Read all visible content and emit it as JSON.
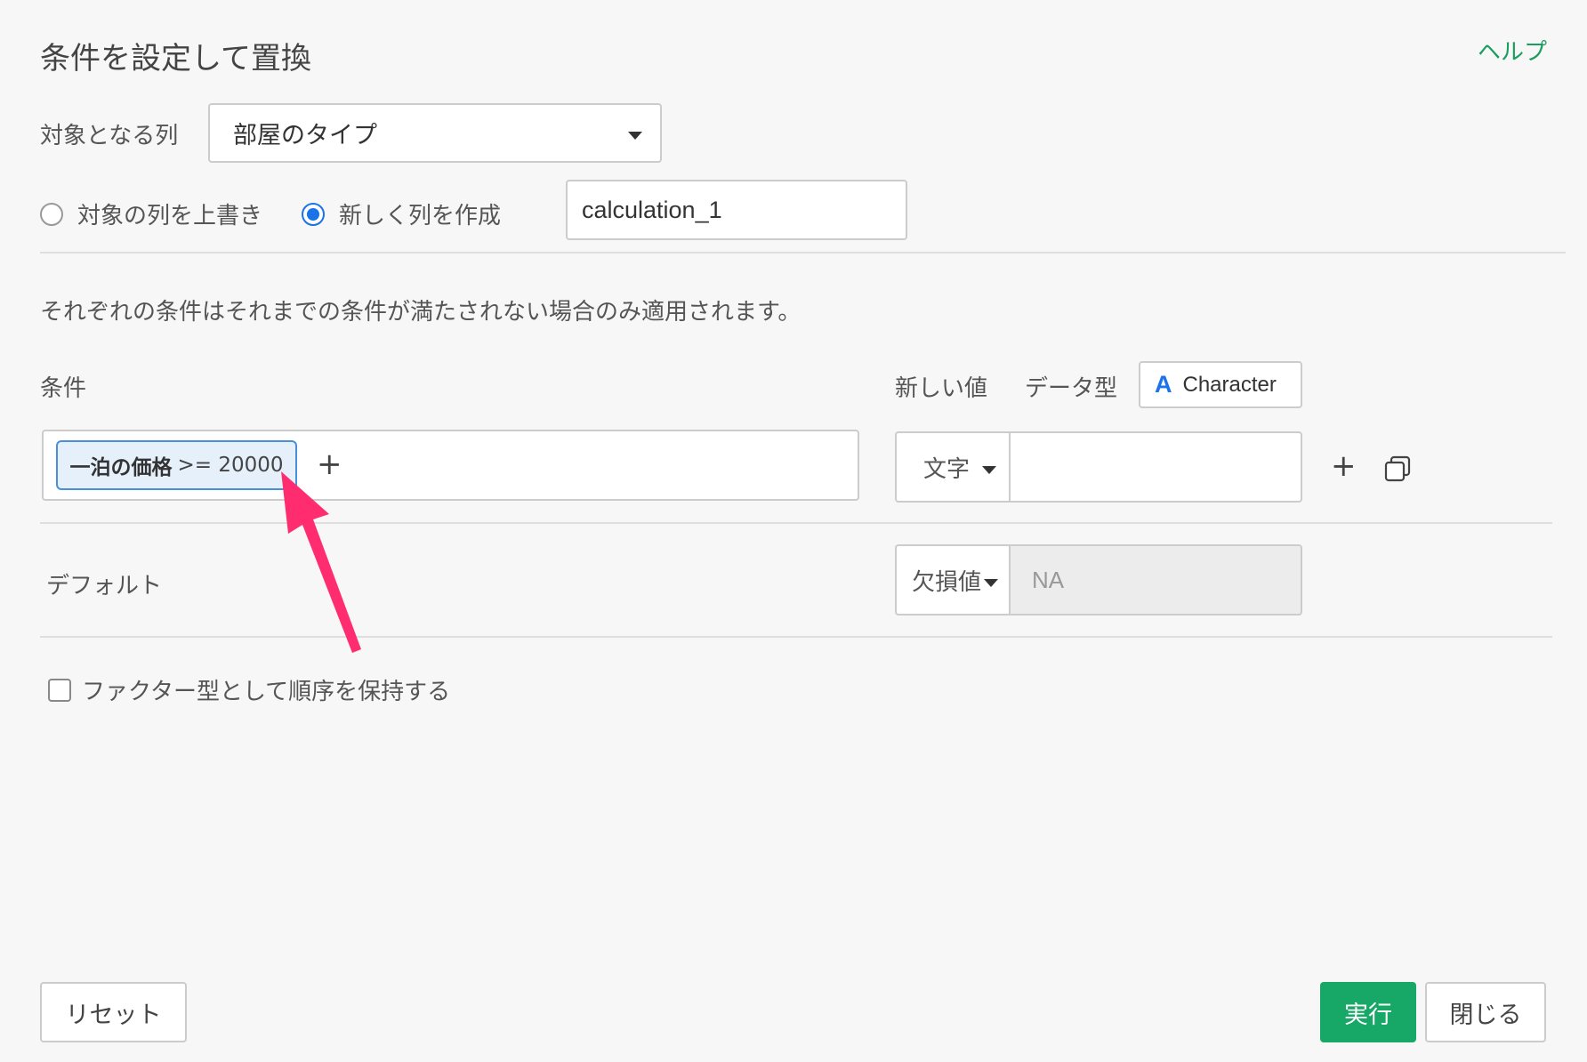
{
  "dialog": {
    "title": "条件を設定して置換",
    "help_label": "ヘルプ"
  },
  "target": {
    "label": "対象となる列",
    "selected": "部屋のタイプ"
  },
  "output": {
    "overwrite_label": "対象の列を上書き",
    "new_column_label": "新しく列を作成",
    "selected": "new_column",
    "new_column_name": "calculation_1"
  },
  "description": "それぞれの条件はそれまでの条件が満たされない場合のみ適用されます。",
  "conditions_header": {
    "condition_label": "条件",
    "new_value_label": "新しい値",
    "data_type_label": "データ型",
    "data_type_icon": "A",
    "data_type_value": "Character"
  },
  "condition_rows": [
    {
      "chip_column": "一泊の価格",
      "chip_expression": ">= 20000",
      "add_symbol": "+",
      "value_type": "文字",
      "value": ""
    }
  ],
  "row_actions": {
    "add_symbol": "+",
    "copy_icon": "copy-icon"
  },
  "default_row": {
    "label": "デフォルト",
    "value_type": "欠損値",
    "value": "NA"
  },
  "factor_option": {
    "label": "ファクター型として順序を保持する",
    "checked": false
  },
  "footer": {
    "reset_label": "リセット",
    "run_label": "実行",
    "close_label": "閉じる"
  },
  "colors": {
    "accent_green": "#17a867",
    "help_green": "#1a9e5f",
    "radio_blue": "#1a73e8",
    "annotation_arrow": "#ff2d6f"
  }
}
